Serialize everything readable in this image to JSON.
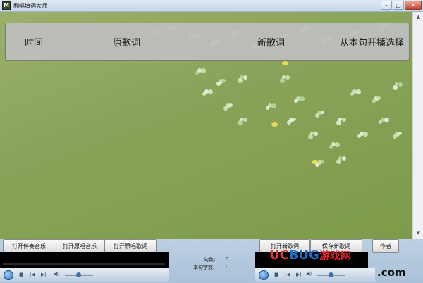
{
  "window": {
    "title": "翻唱填词大师",
    "icon_letter": "M",
    "minimize": "–",
    "maximize": "□",
    "close": "✕"
  },
  "columns": {
    "time": "时间",
    "original": "原歌词",
    "new": "新歌词",
    "play_from": "从本句开播选择"
  },
  "buttons": {
    "open_accompaniment": "打开伴奏音乐",
    "open_original_music": "打开原唱音乐",
    "open_original_lyrics": "打开原唱歌词",
    "open_new_lyrics": "打开新歌词",
    "save_new_lyrics": "保存新歌词",
    "author": "作者"
  },
  "stats": {
    "sentence_count_label": "句数:",
    "sentence_count_value": "0",
    "char_count_label": "本句字数:",
    "char_count_value": "0"
  },
  "player": {
    "seek_start_icon": "»",
    "stop_icon": "■",
    "prev_icon": "|◀",
    "next_icon": "▶|",
    "mute_icon": "🔊"
  },
  "watermark": {
    "uc": "UC",
    "bug": "BUG",
    "cn": "游戏网",
    "dotcom": ".com"
  },
  "colors": {
    "background_green": "#8aa35a",
    "header_band": "#bebebe",
    "player_blue": "#2b6fb5"
  }
}
